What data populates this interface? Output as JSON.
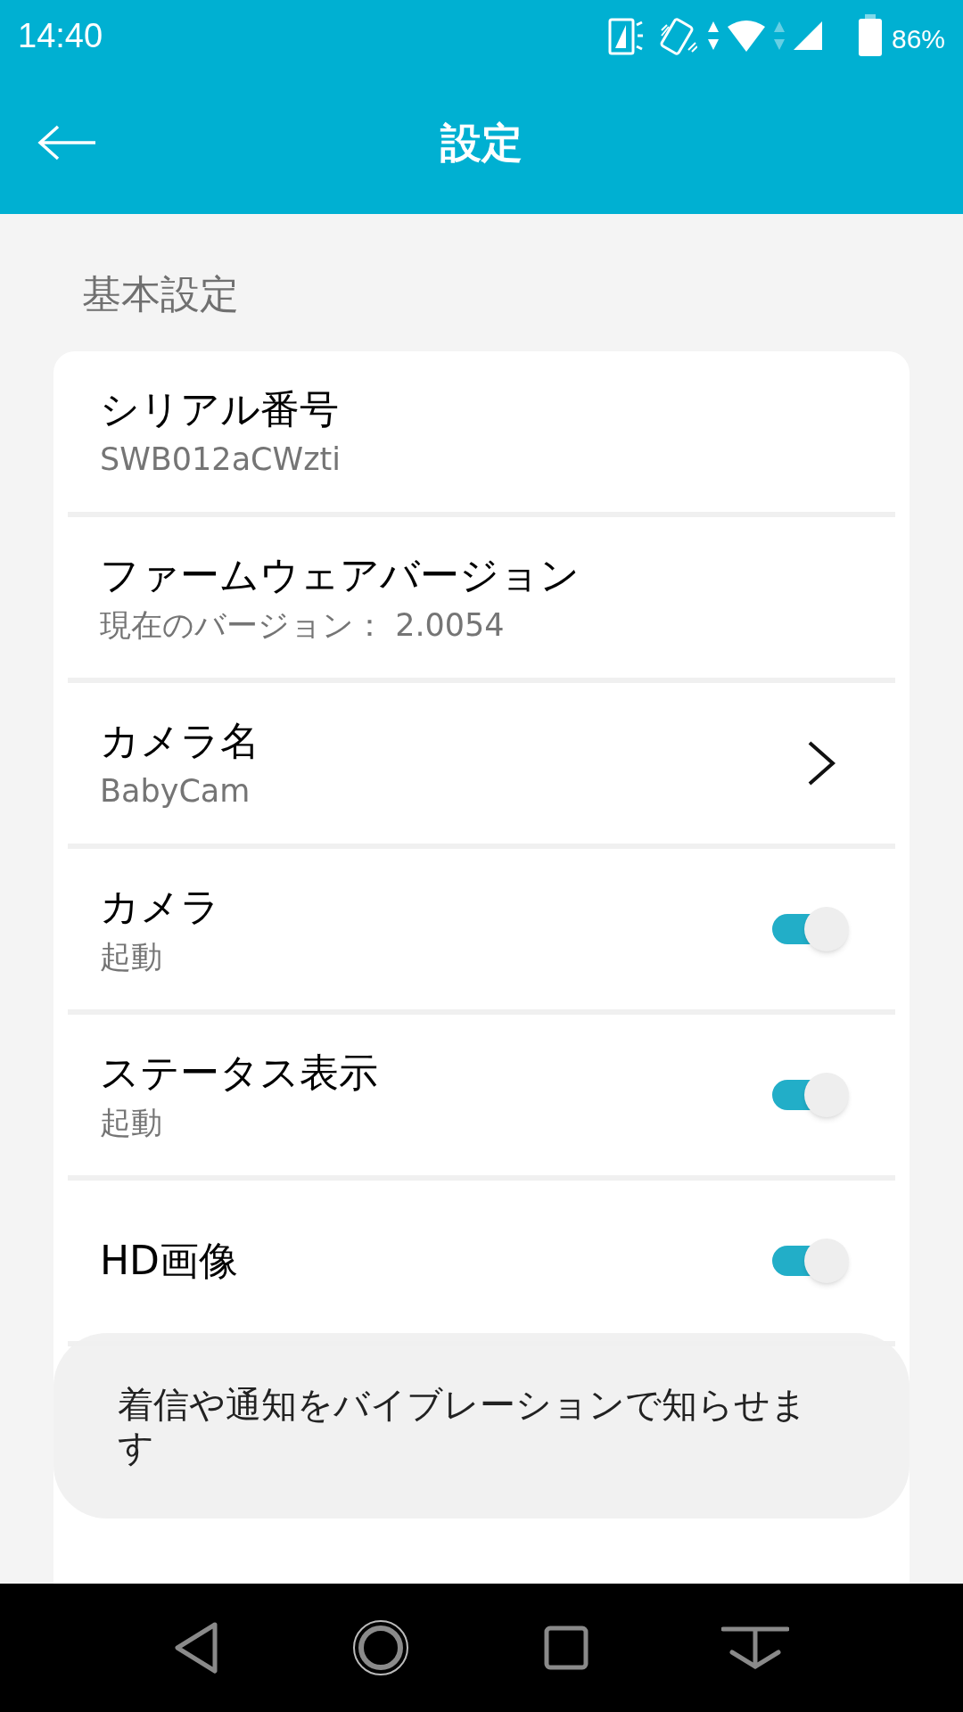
{
  "status_bar": {
    "time": "14:40",
    "battery": "86%"
  },
  "header": {
    "title": "設定"
  },
  "section": {
    "title": "基本設定"
  },
  "rows": [
    {
      "kind": "info",
      "title": "シリアル番号",
      "subtitle": "SWB012aCWzti"
    },
    {
      "kind": "info",
      "title": "ファームウェアバージョン",
      "subtitle": "現在のバージョン： 2.0054"
    },
    {
      "kind": "link",
      "title": "カメラ名",
      "subtitle": "BabyCam"
    },
    {
      "kind": "toggle",
      "title": "カメラ",
      "subtitle": "起動",
      "on": true
    },
    {
      "kind": "toggle",
      "title": "ステータス表示",
      "subtitle": "起動",
      "on": true
    },
    {
      "kind": "toggle",
      "title": "HD画像",
      "on": true
    }
  ],
  "toast": {
    "text": "着信や通知をバイブレーションで知らせます"
  }
}
